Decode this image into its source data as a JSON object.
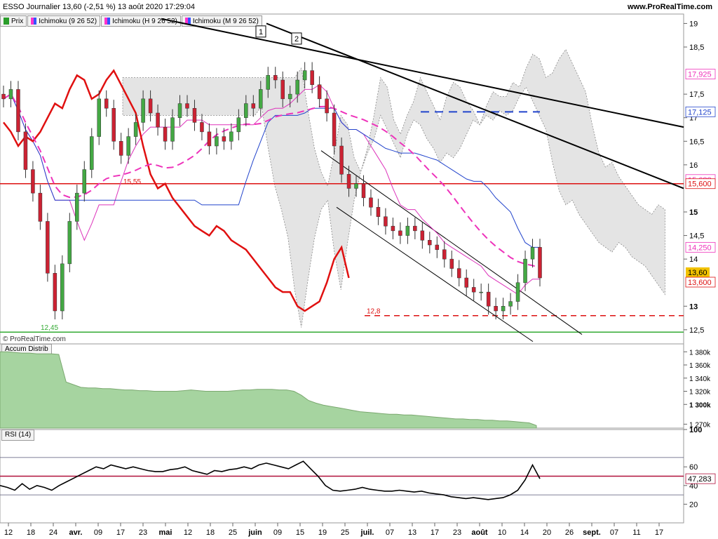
{
  "header": {
    "title": "ESSO Journalier 13,60 (-2,51 %) 13 août 2020 17:29:04",
    "site": "www.ProRealTime.com",
    "watermark": "© ProRealTime.com"
  },
  "legend": [
    {
      "label": "Prix",
      "color": "#2a9d2a"
    },
    {
      "label": "Ichimoku (9 26 52)",
      "color": "#ff33cc"
    },
    {
      "label": "Ichimoku (H 9 26 52)",
      "color": "#3355ff"
    },
    {
      "label": "Ichimoku (M 9 26 52)",
      "color": "#3355ff"
    }
  ],
  "panes": {
    "accum_label": "Accum Distrib",
    "rsi_label": "RSI (14)"
  },
  "colors": {
    "up": "#44a844",
    "down": "#cc2233",
    "tenkan": "#dd33bb",
    "kijun": "#2244cc",
    "chikou": "#e01010",
    "cloud": "#d9d9d9",
    "trend": "#000000",
    "support": "#dd1111",
    "low": "#33aa33",
    "rsi": "#000000",
    "accum": "#a6d4a0",
    "pink": "#ee33bb"
  },
  "chart_data": [
    {
      "type": "candlestick",
      "title": "ESSO Journalier",
      "y_axis_ticks": [
        "19",
        "18,5",
        "17,5",
        "17",
        "16,5",
        "16",
        "15",
        "14,5",
        "14",
        "13",
        "12,5"
      ],
      "y_range": [
        12.2,
        19.2
      ],
      "x_axis_labels": [
        "12",
        "18",
        "24",
        "avr.",
        "09",
        "17",
        "23",
        "mai",
        "12",
        "18",
        "25",
        "juin",
        "09",
        "15",
        "19",
        "25",
        "juil.",
        "07",
        "13",
        "17",
        "23",
        "août",
        "10",
        "14",
        "20",
        "26",
        "sept.",
        "07",
        "11",
        "17"
      ],
      "price_labels": [
        {
          "text": "17,925",
          "value": 17.925,
          "color": "#ee33bb"
        },
        {
          "text": "17,125",
          "value": 17.125,
          "color": "#2244cc"
        },
        {
          "text": "15,688",
          "value": 15.688,
          "color": "#ee33bb"
        },
        {
          "text": "15,600",
          "value": 15.6,
          "color": "#dd1111"
        },
        {
          "text": "14,250",
          "value": 14.25,
          "color": "#ee33bb"
        },
        {
          "text": "13,60",
          "value": 13.6,
          "color": "#000000",
          "highlight": true
        },
        {
          "text": "13,600",
          "value": 13.6,
          "color": "#dd1111"
        }
      ],
      "annotations": [
        {
          "text": "15,55",
          "value": 15.55
        },
        {
          "text": "12,8",
          "value": 12.8
        },
        {
          "text": "12,45",
          "value": 12.45
        },
        {
          "text": "1",
          "value": 18.8
        },
        {
          "text": "2",
          "value": 18.65
        }
      ],
      "closes": [
        17.4,
        17.6,
        16.7,
        15.9,
        15.4,
        14.8,
        13.7,
        12.9,
        13.9,
        14.8,
        15.4,
        15.9,
        16.6,
        17.4,
        17.2,
        16.5,
        16.2,
        16.6,
        16.9,
        17.4,
        17.1,
        16.8,
        16.5,
        17.0,
        17.3,
        17.2,
        16.9,
        16.7,
        16.4,
        16.6,
        16.5,
        16.7,
        17.0,
        17.3,
        17.2,
        17.6,
        17.9,
        17.8,
        17.4,
        17.5,
        17.8,
        18.0,
        17.7,
        17.4,
        17.1,
        16.4,
        15.8,
        15.5,
        15.6,
        15.3,
        15.1,
        14.9,
        14.7,
        14.6,
        14.5,
        14.7,
        14.6,
        14.4,
        14.3,
        14.2,
        14.0,
        13.8,
        13.6,
        13.4,
        13.3,
        13.3,
        13.0,
        12.9,
        13.0,
        13.1,
        13.5,
        14.0,
        14.25,
        13.6
      ]
    },
    {
      "type": "area",
      "title": "Accum Distrib",
      "y_axis_ticks": [
        "1 380k",
        "1 360k",
        "1 340k",
        "1 320k",
        "1 300k",
        "1 270k"
      ],
      "y_range": [
        1264,
        1392
      ],
      "values": [
        1380,
        1380,
        1379,
        1378,
        1378,
        1377,
        1377,
        1377,
        1376,
        1334,
        1330,
        1326,
        1325,
        1325,
        1324,
        1324,
        1323,
        1322,
        1322,
        1321,
        1321,
        1320,
        1320,
        1320,
        1320,
        1321,
        1322,
        1321,
        1320,
        1320,
        1320,
        1320,
        1321,
        1322,
        1322,
        1323,
        1323,
        1323,
        1322,
        1322,
        1320,
        1314,
        1306,
        1302,
        1299,
        1297,
        1295,
        1293,
        1291,
        1289,
        1288,
        1287,
        1286,
        1285,
        1285,
        1284,
        1284,
        1283,
        1282,
        1281,
        1280,
        1279,
        1278,
        1278,
        1277,
        1277,
        1276,
        1276,
        1275,
        1275,
        1274,
        1273,
        1272,
        1268
      ]
    },
    {
      "type": "line",
      "title": "RSI (14)",
      "y_axis_ticks": [
        "100",
        "60",
        "40",
        "20"
      ],
      "y_range": [
        0,
        100
      ],
      "levels": [
        70,
        50,
        30
      ],
      "last_value_label": "47,283",
      "values": [
        40,
        38,
        35,
        42,
        36,
        40,
        38,
        35,
        40,
        44,
        48,
        52,
        56,
        60,
        58,
        62,
        60,
        58,
        60,
        58,
        56,
        55,
        55,
        57,
        58,
        60,
        56,
        54,
        52,
        56,
        55,
        57,
        58,
        60,
        58,
        62,
        64,
        62,
        60,
        58,
        62,
        66,
        58,
        50,
        40,
        35,
        34,
        35,
        36,
        38,
        36,
        35,
        34,
        34,
        35,
        34,
        33,
        34,
        32,
        31,
        30,
        28,
        27,
        26,
        27,
        26,
        25,
        26,
        27,
        30,
        35,
        46,
        62,
        47.3
      ]
    }
  ]
}
